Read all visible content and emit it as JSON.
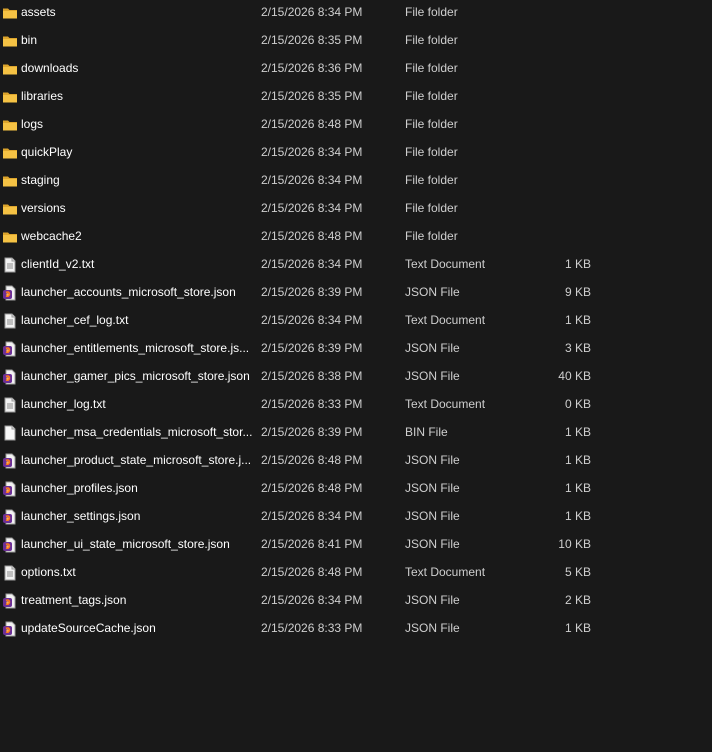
{
  "files": [
    {
      "name": "assets",
      "date": "2/15/2026 8:34 PM",
      "type": "File folder",
      "size": "",
      "icon": "folder-icon"
    },
    {
      "name": "bin",
      "date": "2/15/2026 8:35 PM",
      "type": "File folder",
      "size": "",
      "icon": "folder-icon"
    },
    {
      "name": "downloads",
      "date": "2/15/2026 8:36 PM",
      "type": "File folder",
      "size": "",
      "icon": "folder-icon"
    },
    {
      "name": "libraries",
      "date": "2/15/2026 8:35 PM",
      "type": "File folder",
      "size": "",
      "icon": "folder-icon"
    },
    {
      "name": "logs",
      "date": "2/15/2026 8:48 PM",
      "type": "File folder",
      "size": "",
      "icon": "folder-icon"
    },
    {
      "name": "quickPlay",
      "date": "2/15/2026 8:34 PM",
      "type": "File folder",
      "size": "",
      "icon": "folder-icon"
    },
    {
      "name": "staging",
      "date": "2/15/2026 8:34 PM",
      "type": "File folder",
      "size": "",
      "icon": "folder-icon"
    },
    {
      "name": "versions",
      "date": "2/15/2026 8:34 PM",
      "type": "File folder",
      "size": "",
      "icon": "folder-icon"
    },
    {
      "name": "webcache2",
      "date": "2/15/2026 8:48 PM",
      "type": "File folder",
      "size": "",
      "icon": "folder-icon"
    },
    {
      "name": "clientId_v2.txt",
      "date": "2/15/2026 8:34 PM",
      "type": "Text Document",
      "size": "1 KB",
      "icon": "text-document-icon"
    },
    {
      "name": "launcher_accounts_microsoft_store.json",
      "date": "2/15/2026 8:39 PM",
      "type": "JSON File",
      "size": "9 KB",
      "icon": "json-file-icon"
    },
    {
      "name": "launcher_cef_log.txt",
      "date": "2/15/2026 8:34 PM",
      "type": "Text Document",
      "size": "1 KB",
      "icon": "text-document-icon"
    },
    {
      "name": "launcher_entitlements_microsoft_store.js...",
      "date": "2/15/2026 8:39 PM",
      "type": "JSON File",
      "size": "3 KB",
      "icon": "json-file-icon"
    },
    {
      "name": "launcher_gamer_pics_microsoft_store.json",
      "date": "2/15/2026 8:38 PM",
      "type": "JSON File",
      "size": "40 KB",
      "icon": "json-file-icon"
    },
    {
      "name": "launcher_log.txt",
      "date": "2/15/2026 8:33 PM",
      "type": "Text Document",
      "size": "0 KB",
      "icon": "text-document-icon"
    },
    {
      "name": "launcher_msa_credentials_microsoft_stor...",
      "date": "2/15/2026 8:39 PM",
      "type": "BIN File",
      "size": "1 KB",
      "icon": "blank-file-icon"
    },
    {
      "name": "launcher_product_state_microsoft_store.j...",
      "date": "2/15/2026 8:48 PM",
      "type": "JSON File",
      "size": "1 KB",
      "icon": "json-file-icon"
    },
    {
      "name": "launcher_profiles.json",
      "date": "2/15/2026 8:48 PM",
      "type": "JSON File",
      "size": "1 KB",
      "icon": "json-file-icon"
    },
    {
      "name": "launcher_settings.json",
      "date": "2/15/2026 8:34 PM",
      "type": "JSON File",
      "size": "1 KB",
      "icon": "json-file-icon"
    },
    {
      "name": "launcher_ui_state_microsoft_store.json",
      "date": "2/15/2026 8:41 PM",
      "type": "JSON File",
      "size": "10 KB",
      "icon": "json-file-icon"
    },
    {
      "name": "options.txt",
      "date": "2/15/2026 8:48 PM",
      "type": "Text Document",
      "size": "5 KB",
      "icon": "text-document-icon"
    },
    {
      "name": "treatment_tags.json",
      "date": "2/15/2026 8:34 PM",
      "type": "JSON File",
      "size": "2 KB",
      "icon": "json-file-icon"
    },
    {
      "name": "updateSourceCache.json",
      "date": "2/15/2026 8:33 PM",
      "type": "JSON File",
      "size": "1 KB",
      "icon": "json-file-icon"
    }
  ],
  "colors": {
    "background": "#191919",
    "text_primary": "#ffffff",
    "text_secondary": "#cfcfcf",
    "folder": "#f5c244",
    "json_badge": "#7a3fa0"
  }
}
